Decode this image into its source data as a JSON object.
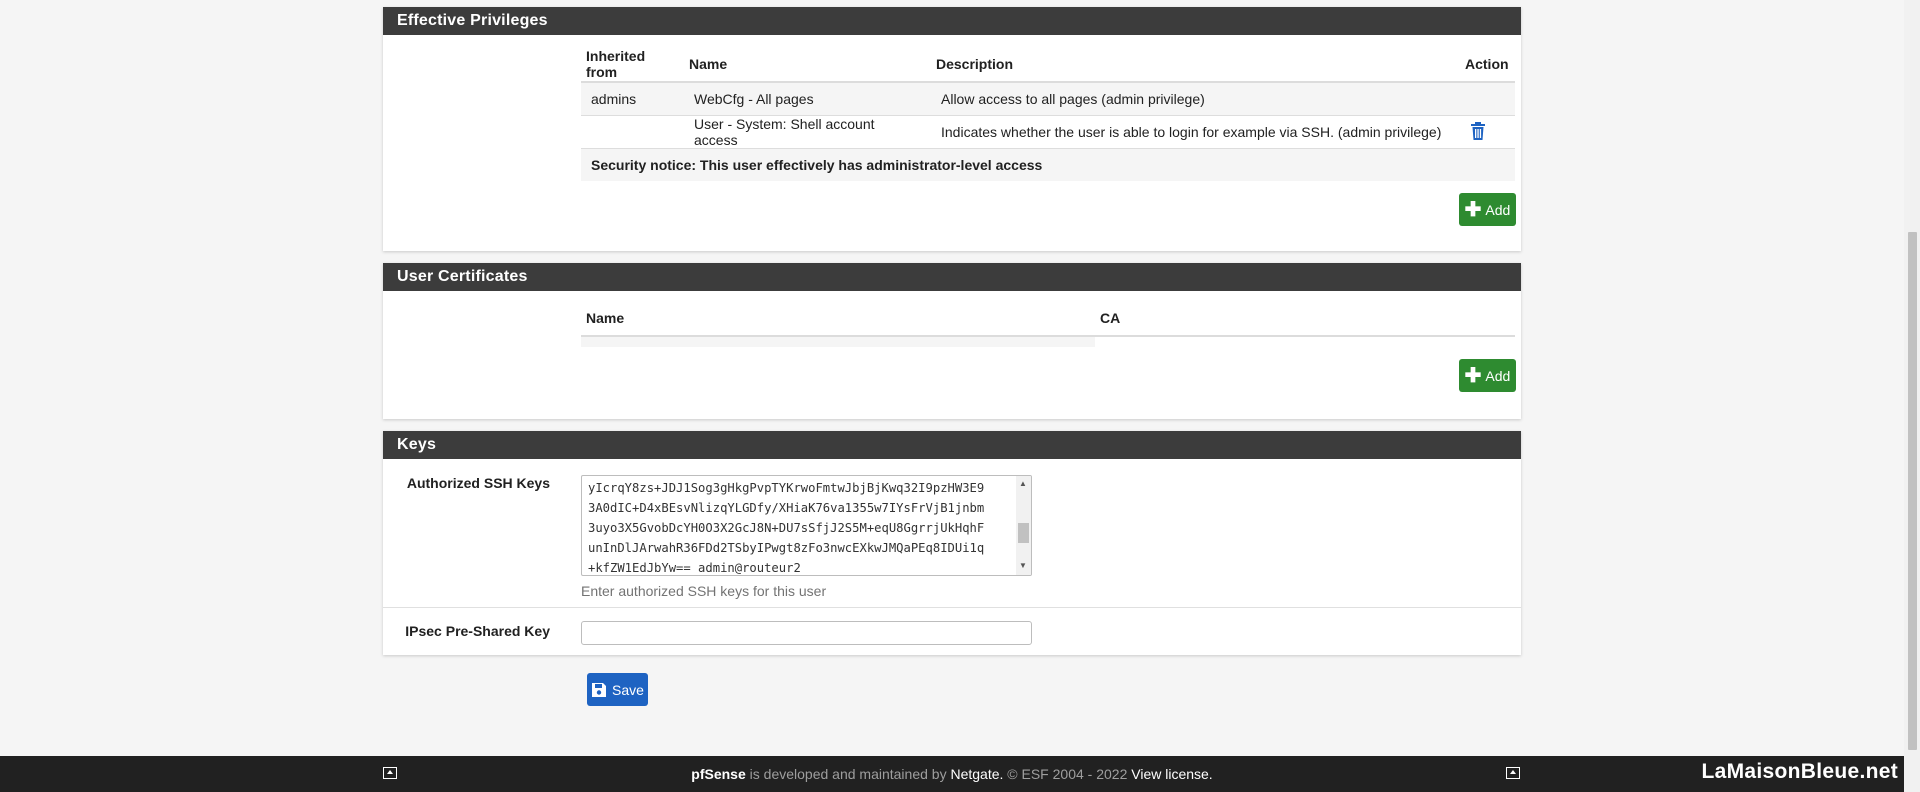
{
  "effective_privileges": {
    "title": "Effective Privileges",
    "columns": [
      "Inherited from",
      "Name",
      "Description",
      "Action"
    ],
    "rows": [
      {
        "inherited": "admins",
        "name": "WebCfg - All pages",
        "description": "Allow access to all pages (admin privilege)"
      },
      {
        "inherited": "",
        "name": "User - System: Shell account access",
        "description": "Indicates whether the user is able to login for example via SSH. (admin privilege)"
      }
    ],
    "notice": "Security notice: This user effectively has administrator-level access",
    "add_label": "Add"
  },
  "user_certificates": {
    "title": "User Certificates",
    "columns": [
      "Name",
      "CA"
    ],
    "add_label": "Add"
  },
  "keys": {
    "title": "Keys",
    "ssh_label": "Authorized SSH Keys",
    "ssh_value": "yIcrqY8zs+JDJ1Sog3gHkgPvpTYKrwoFmtwJbjBjKwq32I9pzHW3E9\n3A0dIC+D4xBEsvNlizqYLGDfy/XHiaK76va1355w7IYsFrVjB1jnbm\n3uyo3X5GvobDcYH0O3X2GcJ8N+DU7sSfjJ2S5M+eqU8GgrrjUkHqhF\nunInDlJArwahR36FDd2TSbyIPwgt8zFo3nwcEXkwJMQaPEq8IDUi1q\n+kfZW1EdJbYw== admin@routeur2",
    "ssh_help": "Enter authorized SSH keys for this user",
    "ipsec_label": "IPsec Pre-Shared Key",
    "ipsec_value": ""
  },
  "save_label": "Save",
  "footer": {
    "product": "pfSense",
    "text1": " is developed and maintained by ",
    "company": "Netgate.",
    "text2": " © ESF 2004 - 2022 ",
    "license": "View license."
  },
  "watermark": "LaMaisonBleue.net",
  "colors": {
    "add_button": "#2e8b30",
    "save_button": "#1e63c2",
    "panel_heading": "#3c3c3c",
    "trash_icon": "#1e63c2"
  }
}
